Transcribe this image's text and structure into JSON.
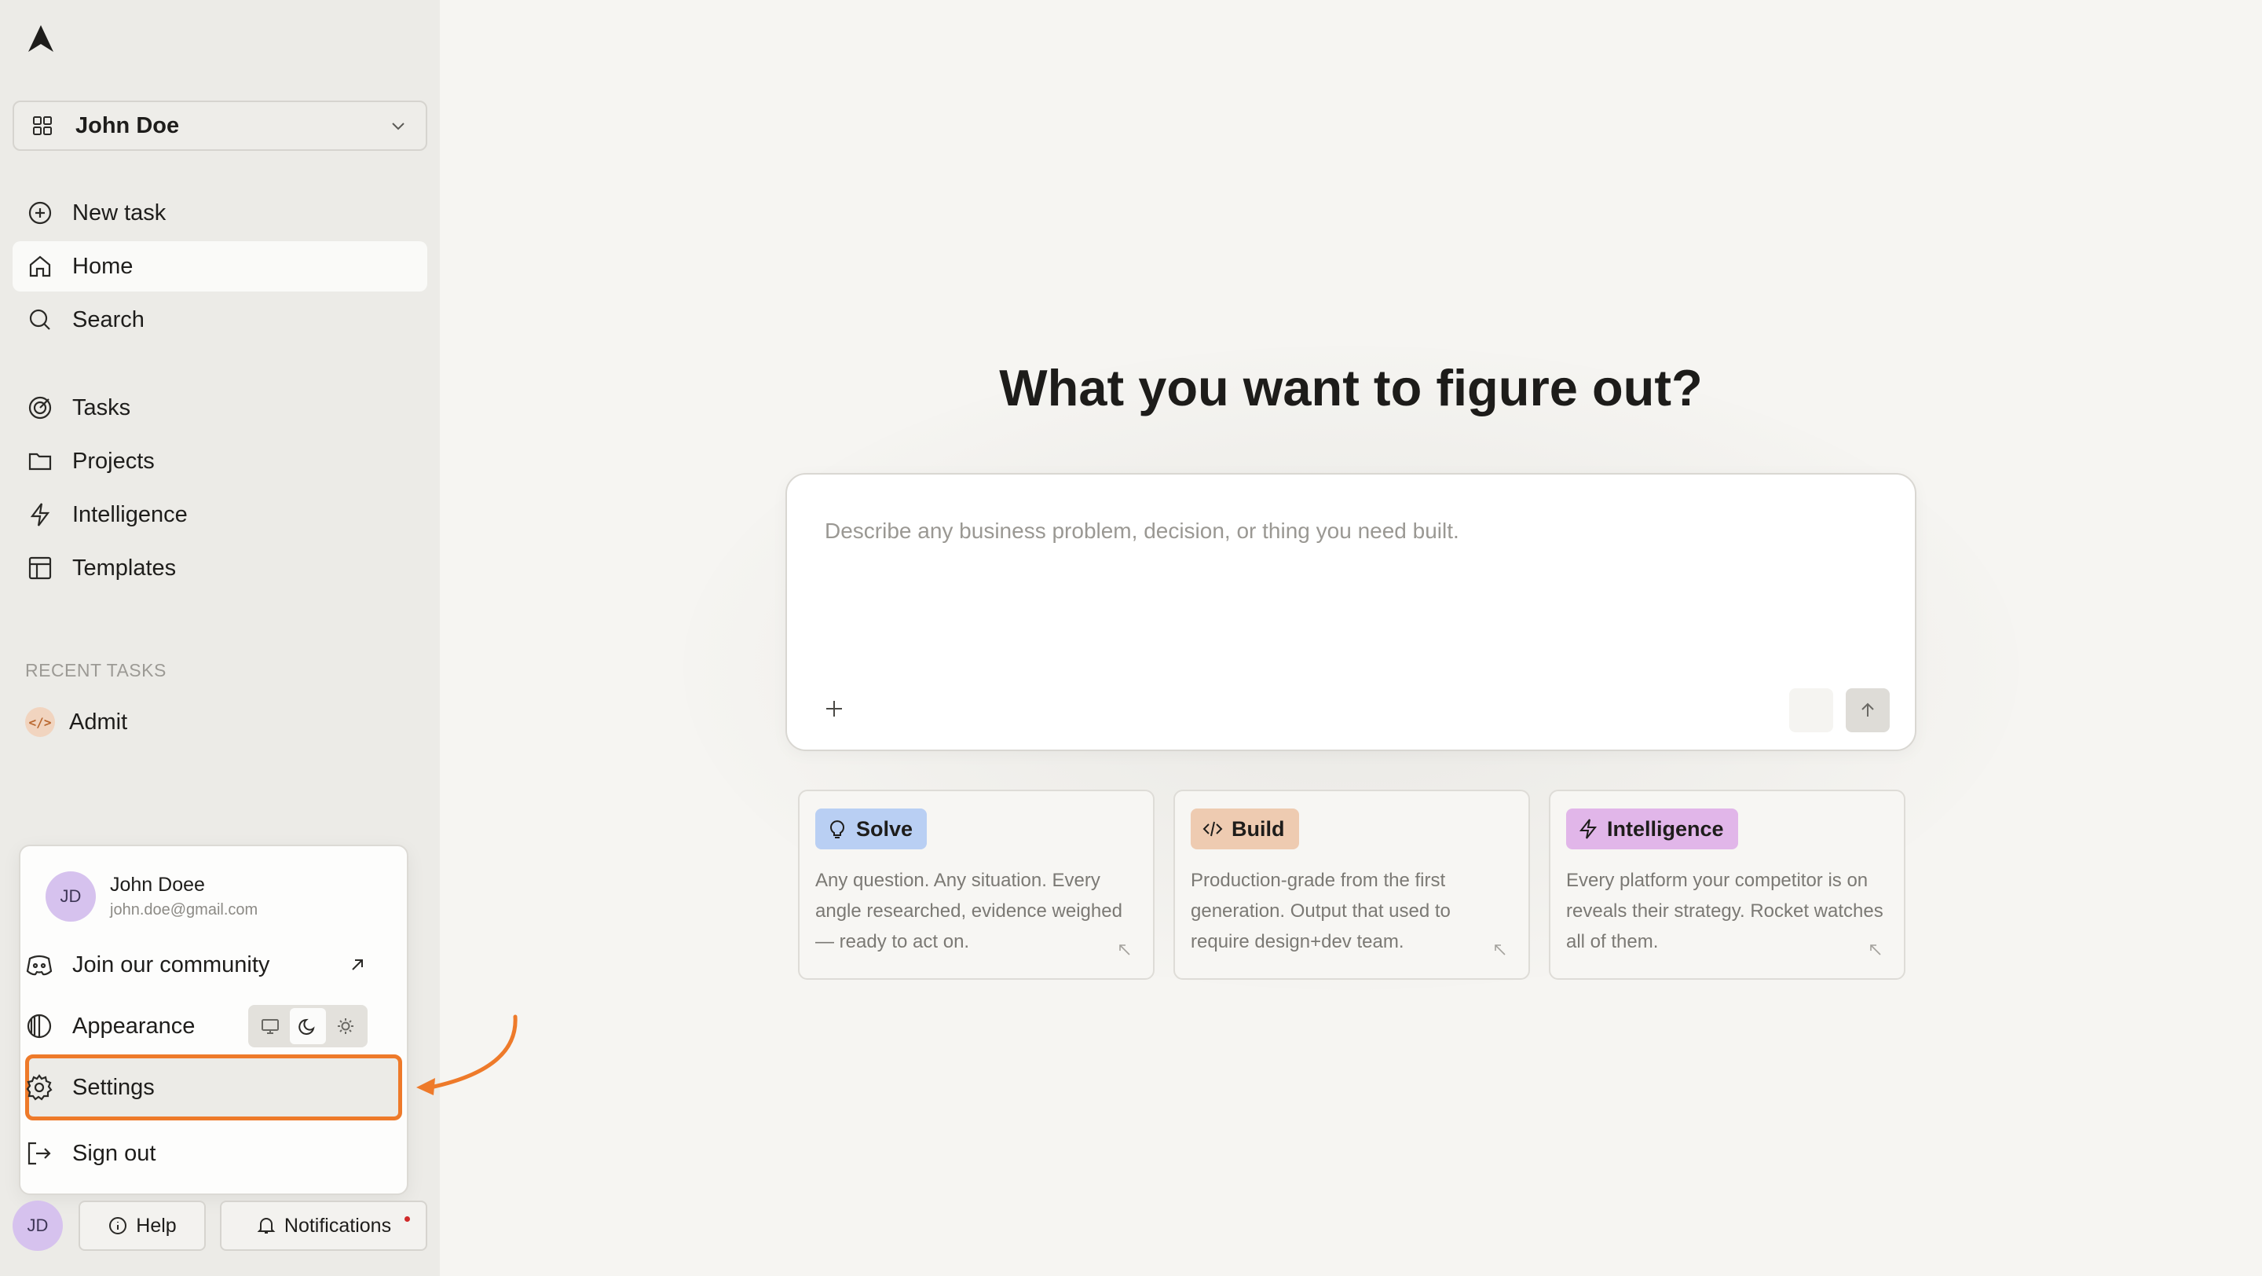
{
  "sidebar": {
    "workspace": {
      "name": "John Doe"
    },
    "nav_primary": [
      {
        "label": "New task",
        "icon": "plus-circle-icon"
      },
      {
        "label": "Home",
        "icon": "home-icon",
        "active": true
      },
      {
        "label": "Search",
        "icon": "search-icon"
      }
    ],
    "nav_secondary": [
      {
        "label": "Tasks",
        "icon": "target-icon"
      },
      {
        "label": "Projects",
        "icon": "folder-icon"
      },
      {
        "label": "Intelligence",
        "icon": "bolt-icon"
      },
      {
        "label": "Templates",
        "icon": "layout-icon"
      }
    ],
    "recent_heading": "RECENT TASKS",
    "recent_tasks": [
      {
        "label": "Admit",
        "icon_text": "</>"
      }
    ]
  },
  "user_menu": {
    "avatar_initials": "JD",
    "name": "John Doee",
    "email": "john.doe@gmail.com",
    "join_label": "Join our community",
    "appearance_label": "Appearance",
    "appearance_selected": "dark",
    "settings_label": "Settings",
    "signout_label": "Sign out"
  },
  "bottom_bar": {
    "avatar_initials": "JD",
    "help_label": "Help",
    "notifications_label": "Notifications"
  },
  "main": {
    "headline": "What you want to figure out?",
    "composer_placeholder": "Describe any business problem, decision, or thing you need built.",
    "cards": [
      {
        "tag": "Solve",
        "icon": "lightbulb-icon",
        "color": "#b9cff3",
        "desc": "Any question. Any situation. Every angle researched, evidence weighed — ready to act on."
      },
      {
        "tag": "Build",
        "icon": "code-icon",
        "color": "#eecbb1",
        "desc": "Production-grade from the first generation. Output that used to require design+dev team."
      },
      {
        "tag": "Intelligence",
        "icon": "bolt-icon",
        "color": "#e1b6e9",
        "desc": "Every platform your competitor is on reveals their strategy. Rocket watches all of them."
      }
    ]
  },
  "colors": {
    "accent_highlight": "#ee7a2a",
    "notification_dot": "#d02a2a"
  }
}
